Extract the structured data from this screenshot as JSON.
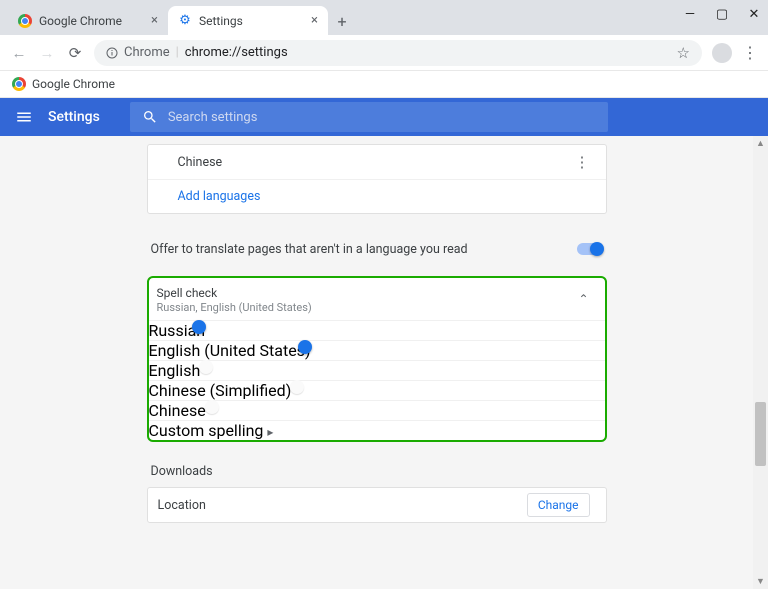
{
  "window": {
    "controls": {
      "min": "—",
      "max": "▢",
      "close": "✕"
    }
  },
  "tabs": {
    "t0": {
      "title": "Google Chrome"
    },
    "t1": {
      "title": "Settings"
    }
  },
  "omnibox": {
    "chrome_label": "Chrome",
    "path": "chrome://settings"
  },
  "bookmarks": {
    "item0": "Google Chrome"
  },
  "header": {
    "title": "Settings",
    "search_placeholder": "Search settings"
  },
  "lang": {
    "chinese": "Chinese",
    "add": "Add languages",
    "translate_offer": "Offer to translate pages that aren't in a language you read"
  },
  "spell": {
    "title": "Spell check",
    "subtitle": "Russian, English (United States)",
    "russian": "Russian",
    "en_us": "English (United States)",
    "en": "English",
    "zh_s": "Chinese (Simplified)",
    "zh": "Chinese",
    "custom": "Custom spelling"
  },
  "downloads": {
    "label": "Downloads",
    "location": "Location",
    "change": "Change"
  }
}
